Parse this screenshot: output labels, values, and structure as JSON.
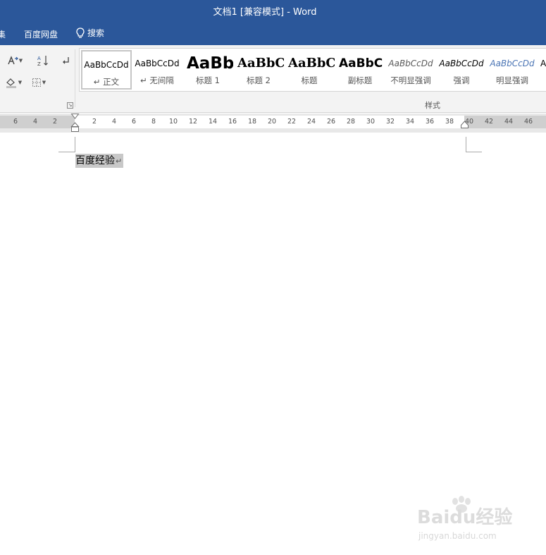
{
  "title_bar": {
    "title": "文档1 [兼容模式] - Word"
  },
  "tabs": [
    {
      "label": "集"
    },
    {
      "label": "百度网盘"
    }
  ],
  "tell_me": {
    "label": "搜索",
    "icon": "lightbulb-icon"
  },
  "ribbon": {
    "paragraph_tools": [
      "text-direction-icon",
      "sort-icon",
      "show-marks-icon",
      "shading-icon",
      "borders-icon"
    ],
    "styles_group_label": "样式",
    "styles": [
      {
        "sample": "AaBbCcDd",
        "name": "↵ 正文",
        "selected": true
      },
      {
        "sample": "AaBbCcDd",
        "name": "↵ 无间隔"
      },
      {
        "sample": "AaBb",
        "name": "标题 1"
      },
      {
        "sample": "AaBbC",
        "name": "标题 2"
      },
      {
        "sample": "AaBbC",
        "name": "标题"
      },
      {
        "sample": "AaBbC",
        "name": "副标题"
      },
      {
        "sample": "AaBbCcDd",
        "name": "不明显强调"
      },
      {
        "sample": "AaBbCcDd",
        "name": "强调"
      },
      {
        "sample": "AaBbCcDd",
        "name": "明显强调"
      },
      {
        "sample": "A",
        "name": ""
      }
    ]
  },
  "ruler": {
    "left_numbers": [
      "6",
      "4",
      "2"
    ],
    "numbers": [
      "2",
      "4",
      "6",
      "8",
      "10",
      "12",
      "14",
      "16",
      "18",
      "20",
      "22",
      "24",
      "26",
      "28",
      "30",
      "32",
      "34",
      "36",
      "38"
    ],
    "right_numbers": [
      "40",
      "42",
      "44",
      "46"
    ]
  },
  "document": {
    "text": "百度经验",
    "paragraph_mark": "↵"
  },
  "watermark": {
    "brand": "Baidu经验",
    "url": "jingyan.baidu.com"
  },
  "colors": {
    "title_bar": "#2b579a",
    "ribbon": "#f3f3f3",
    "selection": "#c8c8c8",
    "emphasis_blue": "#4a74b4"
  }
}
